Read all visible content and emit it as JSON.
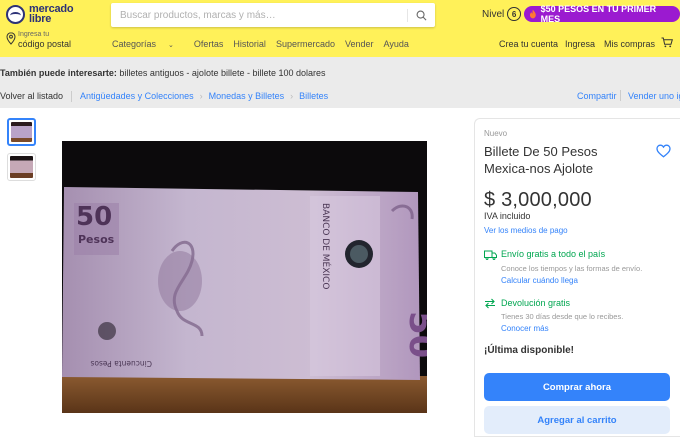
{
  "header": {
    "logo_line1": "mercado",
    "logo_line2": "libre",
    "search_placeholder": "Buscar productos, marcas y más…",
    "nivel_label": "Nivel",
    "nivel_number": "6",
    "promo_text": "$50 PESOS EN TU PRIMER MES",
    "location_small": "Ingresa tu",
    "location_main": "código postal",
    "nav": [
      "Categorías",
      "Ofertas",
      "Historial",
      "Supermercado",
      "Vender",
      "Ayuda"
    ],
    "account": [
      "Crea tu cuenta",
      "Ingresa",
      "Mis compras"
    ],
    "colors": {
      "header_bg": "#fff159",
      "accent": "#3483fa",
      "promo_bg": "#9b1ad0",
      "success": "#00a650"
    }
  },
  "suggestions": {
    "label": "También puede interesarte:",
    "items": "billetes antiguos - ajolote billete - billete 100 dolares"
  },
  "breadcrumb": {
    "back": "Volver al listado",
    "items": [
      "Antigüedades y Colecciones",
      "Monedas y Billetes",
      "Billetes"
    ],
    "share": "Compartir",
    "sell": "Vender uno igual"
  },
  "gallery": {
    "banknote_value": "50",
    "banknote_currency": "Pesos",
    "banknote_issuer": "BANCO DE MÉXICO",
    "banknote_words": "Cincuenta Pesos"
  },
  "product": {
    "condition": "Nuevo",
    "title": "Billete De 50 Pesos Mexica-nos Ajolote",
    "price": "$ 3,000,000",
    "tax": "IVA incluido",
    "payments_link": "Ver los medios de pago",
    "shipping_title": "Envío gratis a todo el país",
    "shipping_sub": "Conoce los tiempos y las formas de envío.",
    "shipping_link": "Calcular cuándo llega",
    "return_title": "Devolución gratis",
    "return_sub": "Tienes 30 días desde que lo recibes.",
    "return_link": "Conocer más",
    "stock": "¡Última disponible!",
    "buy_button": "Comprar ahora",
    "cart_button": "Agregar al carrito"
  }
}
